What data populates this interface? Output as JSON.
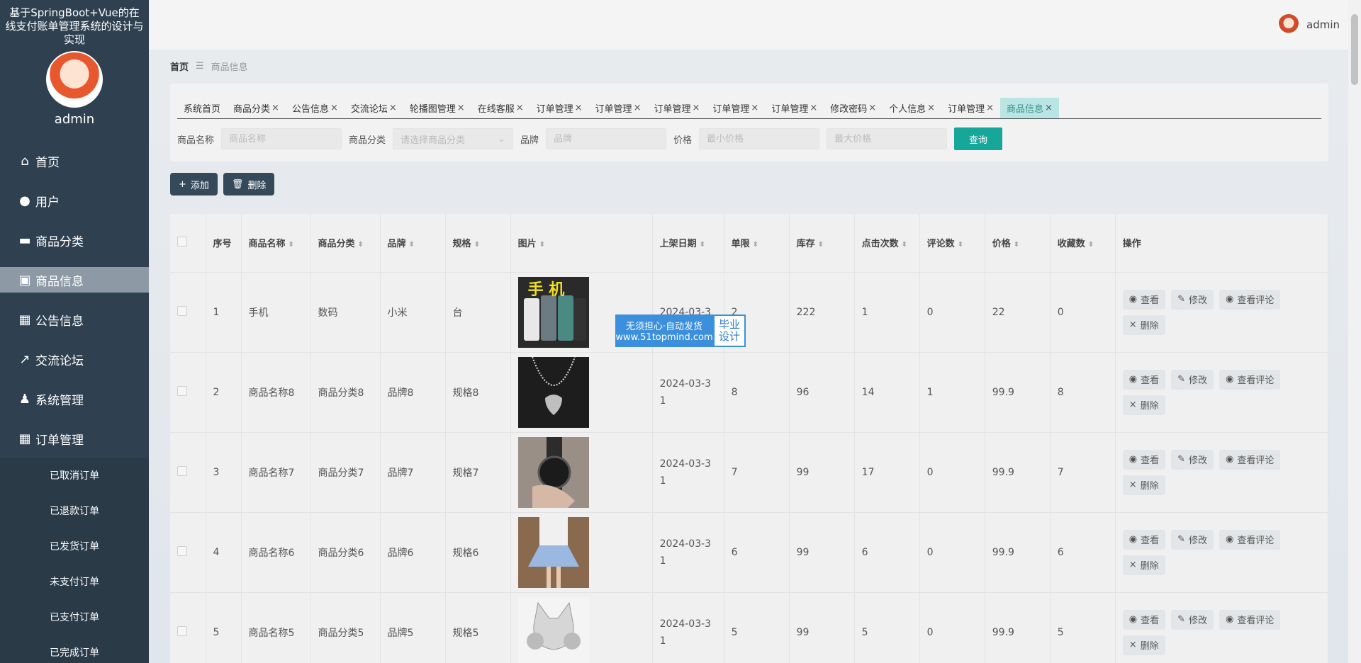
{
  "sidebar": {
    "system_title": "基于SpringBoot+Vue的在线支付账单管理系统的设计与实现",
    "username": "admin",
    "menu": [
      {
        "label": "首页",
        "icon": "home-icon",
        "glyph": "⌂"
      },
      {
        "label": "用户",
        "icon": "bulb-icon",
        "glyph": "●"
      },
      {
        "label": "商品分类",
        "icon": "monitor-icon",
        "glyph": "▬"
      },
      {
        "label": "商品信息",
        "icon": "clipboard-icon",
        "glyph": "▣"
      },
      {
        "label": "公告信息",
        "icon": "grid-icon",
        "glyph": "▦"
      },
      {
        "label": "交流论坛",
        "icon": "chart-icon",
        "glyph": "↗"
      },
      {
        "label": "系统管理",
        "icon": "user-icon",
        "glyph": "♟"
      },
      {
        "label": "订单管理",
        "icon": "grid-icon",
        "glyph": "▦"
      }
    ],
    "submenu": [
      "已取消订单",
      "已退款订单",
      "已发货订单",
      "未支付订单",
      "已支付订单",
      "已完成订单"
    ]
  },
  "header": {
    "username": "admin"
  },
  "breadcrumb": {
    "home": "首页",
    "separator": "☰",
    "current": "商品信息"
  },
  "tabs": [
    {
      "label": "系统首页",
      "closable": false
    },
    {
      "label": "商品分类",
      "closable": true
    },
    {
      "label": "公告信息",
      "closable": true
    },
    {
      "label": "交流论坛",
      "closable": true
    },
    {
      "label": "轮播图管理",
      "closable": true
    },
    {
      "label": "在线客服",
      "closable": true
    },
    {
      "label": "订单管理",
      "closable": true
    },
    {
      "label": "订单管理",
      "closable": true
    },
    {
      "label": "订单管理",
      "closable": true
    },
    {
      "label": "订单管理",
      "closable": true
    },
    {
      "label": "订单管理",
      "closable": true
    },
    {
      "label": "修改密码",
      "closable": true
    },
    {
      "label": "个人信息",
      "closable": true
    },
    {
      "label": "订单管理",
      "closable": true
    },
    {
      "label": "商品信息",
      "closable": true,
      "active": true
    }
  ],
  "search": {
    "name_label": "商品名称",
    "name_placeholder": "商品名称",
    "category_label": "商品分类",
    "category_placeholder": "请选择商品分类",
    "brand_label": "品牌",
    "brand_placeholder": "品牌",
    "price_label": "价格",
    "min_price_placeholder": "最小价格",
    "max_price_placeholder": "最大价格",
    "query_button": "查询"
  },
  "actions": {
    "add": "添加",
    "delete": "删除"
  },
  "table": {
    "columns": [
      "序号",
      "商品名称",
      "商品分类",
      "品牌",
      "规格",
      "图片",
      "上架日期",
      "单限",
      "库存",
      "点击次数",
      "评论数",
      "价格",
      "收藏数",
      "操作"
    ],
    "ops": {
      "view": "查看",
      "edit": "修改",
      "comments": "查看评论",
      "delete": "删除"
    },
    "rows": [
      {
        "no": "1",
        "name": "手机",
        "category": "数码",
        "brand": "小米",
        "spec": "台",
        "image": "phone",
        "date": "2024-03-3",
        "limit": "2",
        "stock": "222",
        "clicks": "1",
        "comments": "0",
        "price": "22",
        "favorites": "0"
      },
      {
        "no": "2",
        "name": "商品名称8",
        "category": "商品分类8",
        "brand": "品牌8",
        "spec": "规格8",
        "image": "necklace",
        "date": "2024-03-31",
        "limit": "8",
        "stock": "96",
        "clicks": "14",
        "comments": "1",
        "price": "99.9",
        "favorites": "8"
      },
      {
        "no": "3",
        "name": "商品名称7",
        "category": "商品分类7",
        "brand": "品牌7",
        "spec": "规格7",
        "image": "watch",
        "date": "2024-03-31",
        "limit": "7",
        "stock": "99",
        "clicks": "17",
        "comments": "0",
        "price": "99.9",
        "favorites": "7"
      },
      {
        "no": "4",
        "name": "商品名称6",
        "category": "商品分类6",
        "brand": "品牌6",
        "spec": "规格6",
        "image": "dress",
        "date": "2024-03-31",
        "limit": "6",
        "stock": "99",
        "clicks": "6",
        "comments": "0",
        "price": "99.9",
        "favorites": "6"
      },
      {
        "no": "5",
        "name": "商品名称5",
        "category": "商品分类5",
        "brand": "品牌5",
        "spec": "规格5",
        "image": "headphones",
        "date": "2024-03-31",
        "limit": "5",
        "stock": "99",
        "clicks": "5",
        "comments": "0",
        "price": "99.9",
        "favorites": "5"
      }
    ]
  },
  "phone_image_text": "手 机",
  "watermark": {
    "line1": "无须担心·自动发货",
    "line2": "www.51topmind.com",
    "badge1": "毕业",
    "badge2": "设计"
  },
  "colors": {
    "sidebar_bg": "#2f4150",
    "accent": "#17a69a",
    "active_tab": "#b9e6e4"
  }
}
